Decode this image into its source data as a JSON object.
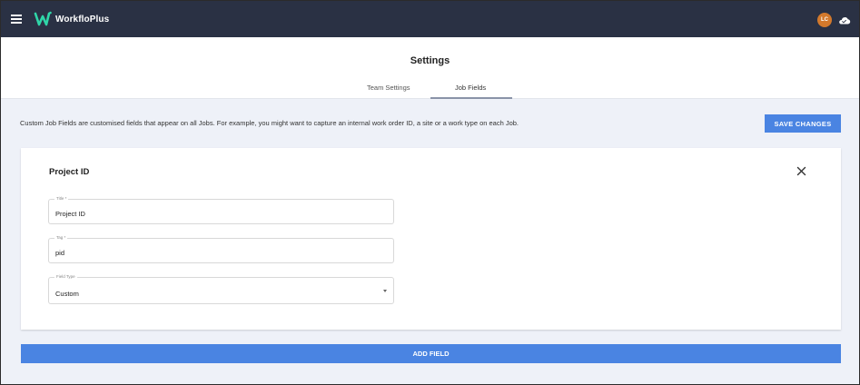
{
  "app": {
    "name": "WorkfloPlus",
    "avatar_initials": "LC",
    "brand_color": "#2a3144",
    "accent_color": "#4a84e2",
    "logo_color": "#2fd6a8",
    "avatar_color": "#d3792c"
  },
  "topbar": {
    "menu_icon": "hamburger-icon",
    "cloud_icon": "cloud-icon"
  },
  "page": {
    "title": "Settings",
    "tabs": [
      {
        "label": "Team Settings",
        "active": false
      },
      {
        "label": "Job Fields",
        "active": true
      }
    ]
  },
  "content": {
    "description": "Custom Job Fields are customised fields that appear on all Jobs. For example, you might want to capture an internal work order ID, a site or a work type on each Job.",
    "save_label": "SAVE CHANGES",
    "add_field_label": "ADD FIELD"
  },
  "field_card": {
    "title": "Project ID",
    "close_icon": "close-icon",
    "fields": [
      {
        "label": "Title *",
        "value": "Project ID"
      },
      {
        "label": "Tag *",
        "value": "pid"
      },
      {
        "label": "Field Type",
        "value": "Custom"
      }
    ]
  }
}
